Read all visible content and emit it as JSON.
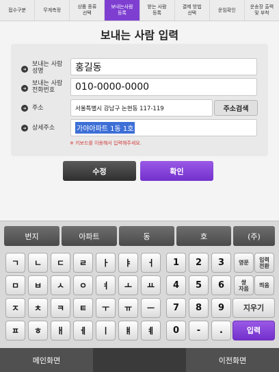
{
  "steps": [
    {
      "label": "접수구분",
      "active": false
    },
    {
      "label": "무게측정",
      "active": false
    },
    {
      "label": "상품 종류\n선택",
      "active": false
    },
    {
      "label": "보내는사람\n등록",
      "active": true
    },
    {
      "label": "받는 사람\n등록",
      "active": false
    },
    {
      "label": "결제 방법\n선택",
      "active": false
    },
    {
      "label": "운임확인",
      "active": false
    },
    {
      "label": "운송장 출력\n및 부착",
      "active": false
    }
  ],
  "title": "보내는 사람 입력",
  "form": {
    "name_label": "보내는 사람\n성명",
    "name_value": "홍길동",
    "phone_label": "보내는 사람\n전화번호",
    "phone_value": "010-0000-0000",
    "address_label": "주소",
    "address_value": "서울특별시 강남구 논현동  117-119",
    "address_search": "주소검색",
    "detail_label": "상세주소",
    "detail_value": "가야아파트 1동 1호",
    "note": "※ 키보드를 이용해서 입력해주세요."
  },
  "actions": {
    "edit": "수정",
    "confirm": "확인"
  },
  "keyboard": {
    "shortcuts": [
      "번지",
      "아파트",
      "동",
      "호",
      "(주)"
    ],
    "rows": [
      [
        "ㄱ",
        "ㄴ",
        "ㄷ",
        "ㄹ",
        "ㅏ",
        "ㅑ",
        "ㅓ",
        "1",
        "2",
        "3"
      ],
      [
        "ㅁ",
        "ㅂ",
        "ㅅ",
        "ㅇ",
        "ㅕ",
        "ㅗ",
        "ㅛ",
        "4",
        "5",
        "6"
      ],
      [
        "ㅈ",
        "ㅊ",
        "ㅋ",
        "ㅌ",
        "ㅜ",
        "ㅠ",
        "ㅡ",
        "7",
        "8",
        "9"
      ],
      [
        "ㅍ",
        "ㅎ",
        "ㅐ",
        "ㅔ",
        "ㅣ",
        "ㅒ",
        "ㅖ",
        "0",
        "-",
        "."
      ]
    ],
    "lang": "영문",
    "mode": "입력\n전환",
    "double": "쌍\n자음",
    "space": "띄움",
    "erase": "지우기",
    "enter": "입력"
  },
  "bottom": {
    "main": "메인화면",
    "prev": "이전화면"
  },
  "colors": {
    "accent": "#7e3fd1",
    "selection": "#3d6fd6",
    "note": "#d13b3b"
  }
}
